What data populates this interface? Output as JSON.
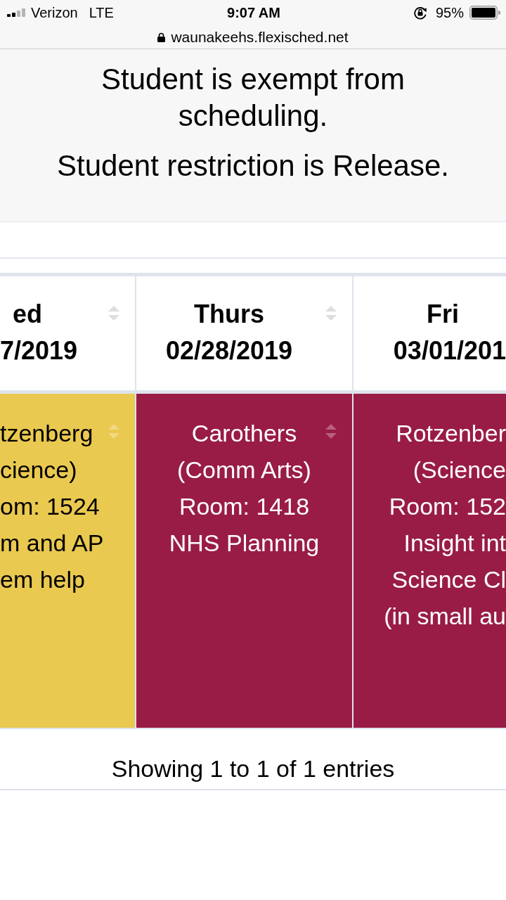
{
  "status_bar": {
    "carrier": "Verizon",
    "network": "LTE",
    "time": "9:07 AM",
    "battery": "95%"
  },
  "address_bar": {
    "url": "waunakeehs.flexisched.net"
  },
  "notices": [
    "Student is exempt from scheduling.",
    "Student restriction is Release."
  ],
  "schedule_table": {
    "columns": [
      {
        "day": "ed",
        "date": "7/2019",
        "sort_icon": true
      },
      {
        "day": "Thurs",
        "date": "02/28/2019",
        "sort_icon": true
      },
      {
        "day": "Fri",
        "date": "03/01/201",
        "sort_icon": false
      }
    ],
    "rows": [
      {
        "cells": [
          {
            "color": "#eac950",
            "sort_icon": true,
            "lines": [
              "tzenberg",
              "cience)",
              "om: 1524",
              "m and AP",
              "em help"
            ]
          },
          {
            "color": "#991c46",
            "sort_icon": true,
            "lines": [
              "Carothers",
              "(Comm Arts)",
              "Room: 1418",
              "NHS Planning"
            ]
          },
          {
            "color": "#991c46",
            "sort_icon": false,
            "lines": [
              "Rotzenber",
              "(Science",
              "Room: 152",
              "Insight int",
              "Science Cl",
              "(in small au"
            ]
          }
        ]
      }
    ]
  },
  "footer": {
    "info": "Showing 1 to 1 of 1 entries"
  }
}
